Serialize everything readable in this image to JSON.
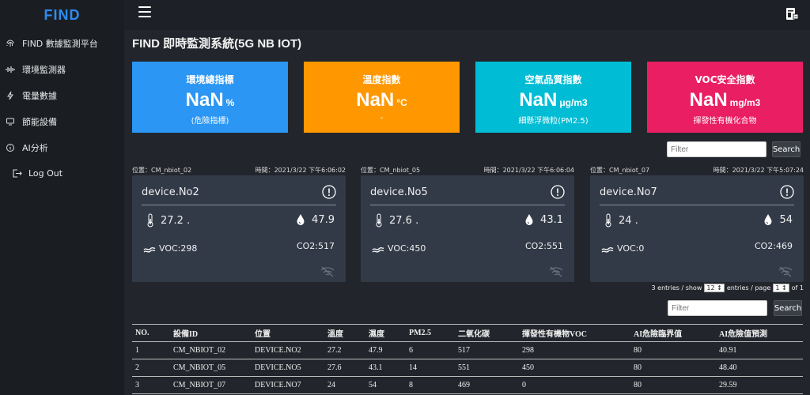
{
  "sidebar": {
    "logo": "FIND",
    "items": [
      {
        "label": "FIND 數據監測平台",
        "icon": "fingerprint-icon"
      },
      {
        "label": "環境監測器",
        "icon": "soundwave-icon"
      },
      {
        "label": "電量數據",
        "icon": "lightning-icon"
      },
      {
        "label": "節能設備",
        "icon": "monitor-icon"
      },
      {
        "label": "AI分析",
        "icon": "info-icon"
      }
    ],
    "logout": "Log Out"
  },
  "page_title": "FIND 即時監測系統(5G NB IOT)",
  "stats": [
    {
      "title": "環境總指標",
      "value": "NaN",
      "unit": "%",
      "sub": "(危險指標)",
      "color": "#2b96f3"
    },
    {
      "title": "溫度指數",
      "value": "NaN",
      "unit": "°C",
      "sub": "-",
      "color": "#ff9800"
    },
    {
      "title": "空氣品質指數",
      "value": "NaN",
      "unit": "μg/m3",
      "sub": "細懸浮微粒(PM2.5)",
      "color": "#00bcd4"
    },
    {
      "title": "VOC安全指數",
      "value": "NaN",
      "unit": "mg/m3",
      "sub": "揮發性有機化合物",
      "color": "#e91e63"
    }
  ],
  "filter": {
    "placeholder": "Filter",
    "search": "Search"
  },
  "devices": [
    {
      "location": "位置：CM_nbiot_02",
      "time": "時間：2021/3/22 下午6:06:02",
      "name": "device.No2",
      "temp": "27.2 .",
      "humidity": "47.9",
      "voc": "VOC:298",
      "co2": "CO2:517"
    },
    {
      "location": "位置：CM_nbiot_05",
      "time": "時間：2021/3/22 下午6:06:04",
      "name": "device.No5",
      "temp": "27.6 .",
      "humidity": "43.1",
      "voc": "VOC:450",
      "co2": "CO2:551"
    },
    {
      "location": "位置：CM_nbiot_07",
      "time": "時間：2021/3/22 下午5:07:24",
      "name": "device.No7",
      "temp": "24 .",
      "humidity": "54",
      "voc": "VOC:0",
      "co2": "CO2:469"
    }
  ],
  "pager": {
    "entries_show": "3 entries / show",
    "per_page": "12",
    "entries_page": "entries / page",
    "page": "1",
    "of": "of 1"
  },
  "table": {
    "headers": [
      "NO.",
      "設備ID",
      "位置",
      "溫度",
      "濕度",
      "PM2.5",
      "二氧化碳",
      "揮發性有機物VOC",
      "AI危險臨界值",
      "AI危險值預測"
    ],
    "rows": [
      [
        "1",
        "CM_NBIOT_02",
        "DEVICE.NO2",
        "27.2",
        "47.9",
        "6",
        "517",
        "298",
        "80",
        "40.91"
      ],
      [
        "2",
        "CM_NBIOT_05",
        "DEVICE.NO5",
        "27.6",
        "43.1",
        "14",
        "551",
        "450",
        "80",
        "48.40"
      ],
      [
        "3",
        "CM_NBIOT_07",
        "DEVICE.NO7",
        "24",
        "54",
        "8",
        "469",
        "0",
        "80",
        "29.59"
      ]
    ]
  }
}
